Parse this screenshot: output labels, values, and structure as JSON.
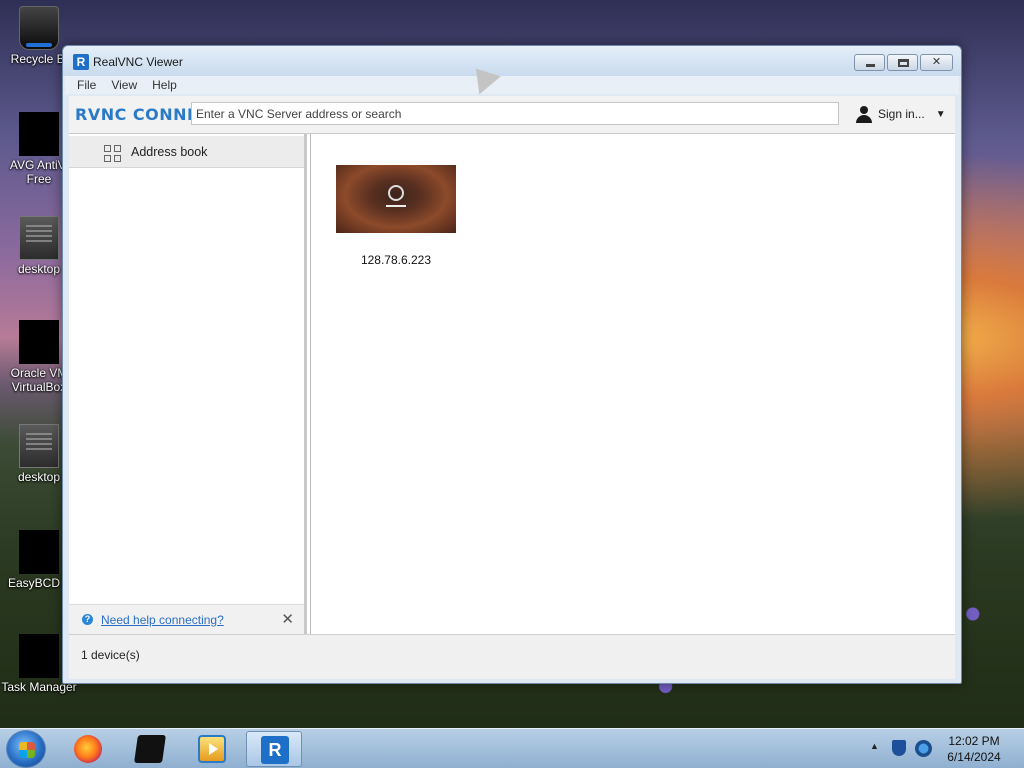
{
  "desktop": {
    "icons": [
      {
        "label": "Recycle Bi"
      },
      {
        "label": "AVG AntiVi",
        "label2": "Free"
      },
      {
        "label": "desktop"
      },
      {
        "label": "Oracle VM",
        "label2": "VirtualBox"
      },
      {
        "label": "desktop"
      },
      {
        "label": "EasyBCD 2"
      },
      {
        "label": "Task Manager"
      }
    ]
  },
  "window": {
    "title": "RealVNC Viewer",
    "menu": [
      "File",
      "View",
      "Help"
    ],
    "brand": "RVNC CONNECT",
    "search_placeholder": "Enter a VNC Server address or search",
    "sign_in_label": "Sign in...",
    "sidebar": {
      "items": [
        {
          "label": "Address book",
          "icon": "grid-icon"
        }
      ],
      "help_link": "Need help connecting?"
    },
    "devices": [
      {
        "label": "128.78.6.223"
      }
    ],
    "status": "1 device(s)"
  },
  "taskbar": {
    "items": [
      "start-button",
      "firefox",
      "virtualbox-box",
      "media-player",
      "realvnc-viewer"
    ],
    "time": "12:02 PM",
    "date": "6/14/2024"
  }
}
